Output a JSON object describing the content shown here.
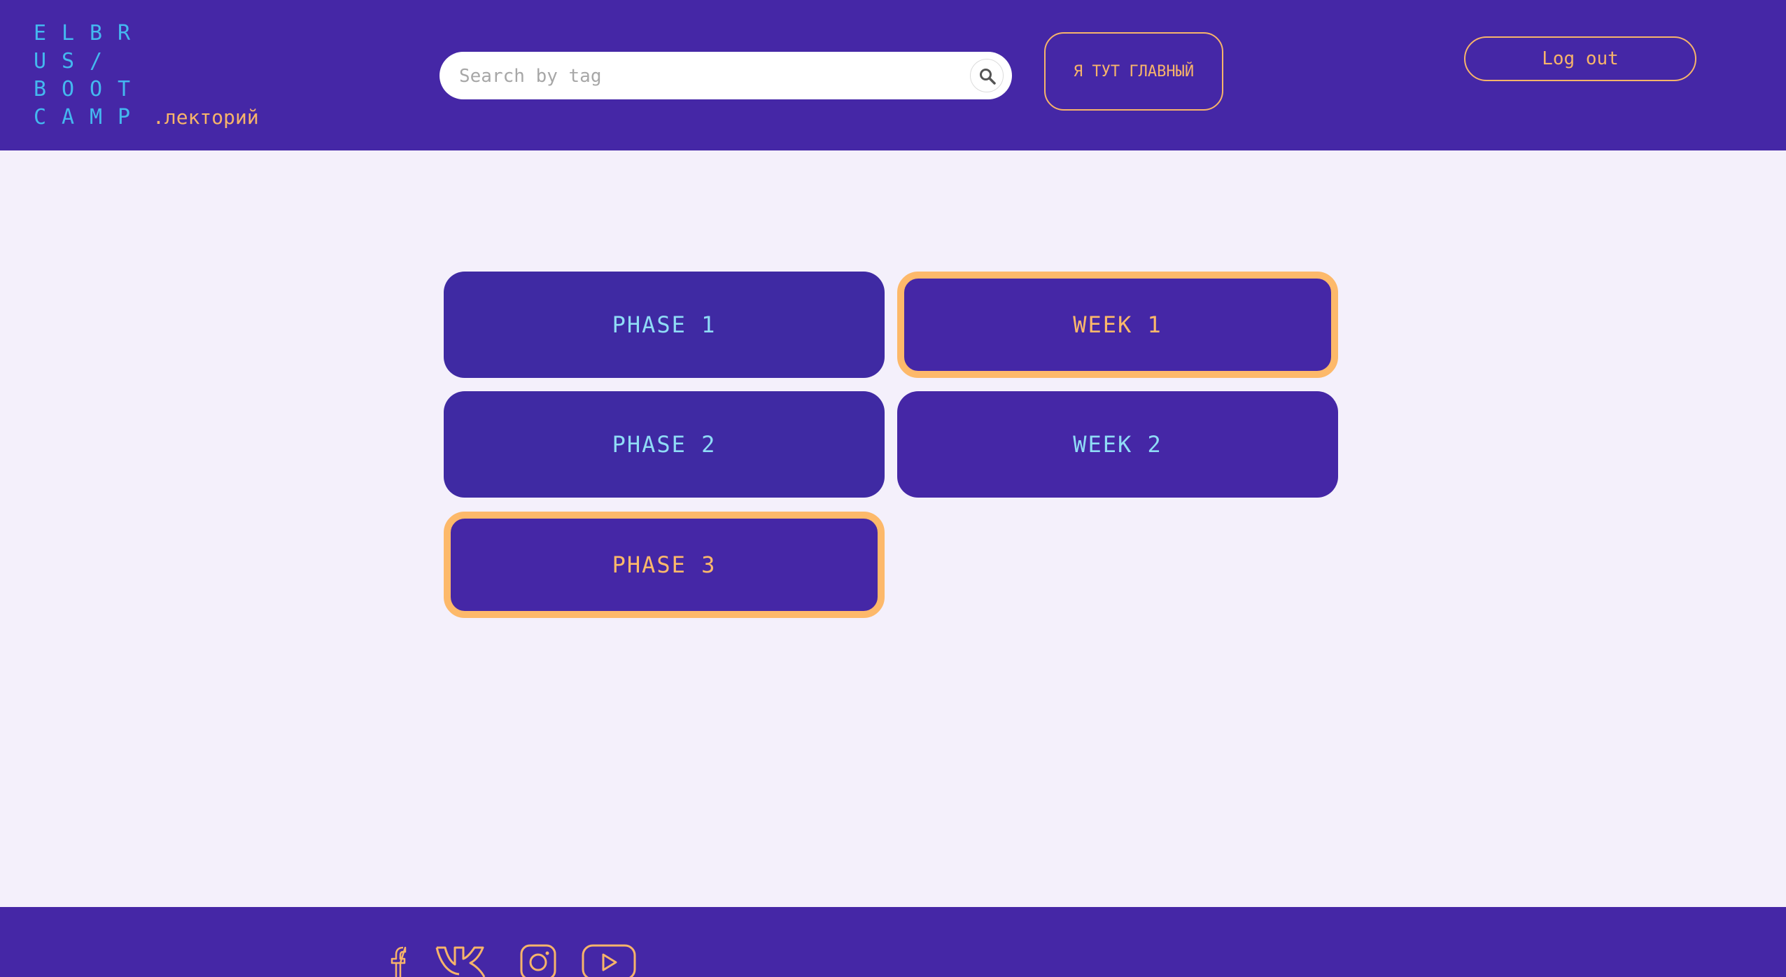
{
  "logo": {
    "rows": [
      [
        "E",
        "L",
        "B",
        "R"
      ],
      [
        "U",
        "S",
        "/"
      ],
      [
        "B",
        "O",
        "O",
        "T"
      ],
      [
        "C",
        "A",
        "M",
        "P"
      ]
    ],
    "suffix": ".лекторий"
  },
  "header": {
    "search_placeholder": "Search by tag",
    "main_button_label": "Я ТУТ ГЛАВНЫЙ",
    "logout_label": "Log out"
  },
  "tiles": {
    "phase_1": "PHASE 1",
    "phase_2": "PHASE 2",
    "phase_3": "PHASE 3",
    "week_1": "WEEK 1",
    "week_2": "WEEK 2"
  },
  "footer": {
    "icons": [
      "facebook-icon",
      "vk-icon",
      "instagram-icon",
      "youtube-icon"
    ]
  },
  "colors": {
    "header_bg": "#4527a6",
    "page_bg": "#f4f0fb",
    "accent_orange": "#fdb96a",
    "accent_cyan": "#8fdcf6",
    "logo_blue": "#44b8ef"
  }
}
